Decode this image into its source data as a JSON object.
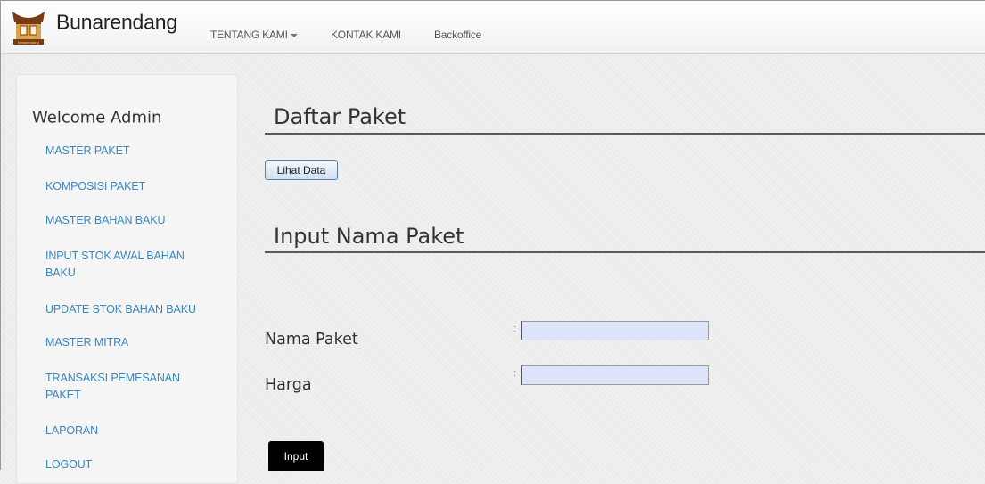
{
  "navbar": {
    "brand": "Bunarendang",
    "logo_caption": "bunarendang",
    "items": [
      {
        "label": "TENTANG KAMI",
        "has_dropdown": true
      },
      {
        "label": "KONTAK KAMI"
      },
      {
        "label": "Backoffice"
      }
    ]
  },
  "sidebar": {
    "welcome": "Welcome Admin",
    "menu": [
      "MASTER PAKET",
      "KOMPOSISI PAKET",
      "MASTER BAHAN BAKU",
      "INPUT STOK AWAL BAHAN BAKU",
      "UPDATE STOK BAHAN BAKU",
      "MASTER MITRA",
      "TRANSAKSI PEMESANAN PAKET",
      "LAPORAN",
      "LOGOUT"
    ]
  },
  "main": {
    "daftar_title": "Daftar Paket",
    "lihat_button": "Lihat Data",
    "input_title": "Input Nama Paket",
    "fields": [
      {
        "label": "Nama Paket",
        "separator": ":",
        "value": ""
      },
      {
        "label": "Harga",
        "separator": ":",
        "value": ""
      }
    ],
    "submit_button": "Input"
  },
  "colors": {
    "link": "#3a87c0",
    "input_bg": "#dde3fb",
    "submit_bg": "#000000",
    "logo_brown": "#7a3b12",
    "logo_gold": "#d8a54a"
  }
}
